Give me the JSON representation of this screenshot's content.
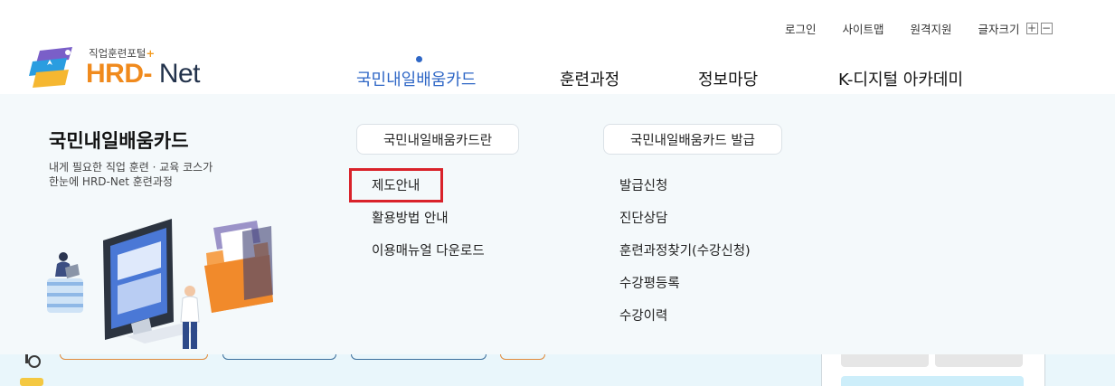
{
  "header": {
    "util_links": [
      "로그인",
      "사이트맵",
      "원격지원"
    ],
    "font_size_label": "글자크기",
    "font_size_plus": "+",
    "font_size_minus": "−"
  },
  "logo": {
    "tagline": "직업훈련포털",
    "tagline_plus": "+",
    "brand_hrd": "HRD",
    "brand_dash": "-",
    "brand_net": " Net"
  },
  "nav": {
    "items": [
      "국민내일배움카드",
      "훈련과정",
      "정보마당",
      "K-디지털 아카데미"
    ],
    "active_index": 0
  },
  "dropdown": {
    "title": "국민내일배움카드",
    "description": [
      "내게 필요한 직업 훈련 · 교육 코스가",
      "한눈에 HRD-Net 훈련과정"
    ],
    "groups": [
      {
        "heading": "국민내일배움카드란",
        "items": [
          "제도안내",
          "활용방법 안내",
          "이용매뉴얼 다운로드"
        ]
      },
      {
        "heading": "국민내일배움카드 발급",
        "items": [
          "발급신청",
          "진단상담",
          "훈련과정찾기(수강신청)",
          "수강평등록",
          "수강이력"
        ]
      }
    ],
    "highlighted_item": "제도안내"
  },
  "colors": {
    "accent_blue": "#2f67c6",
    "logo_orange": "#f08a1d",
    "highlight_red": "#d9222a",
    "dropdown_bg": "#f4f9fb"
  }
}
